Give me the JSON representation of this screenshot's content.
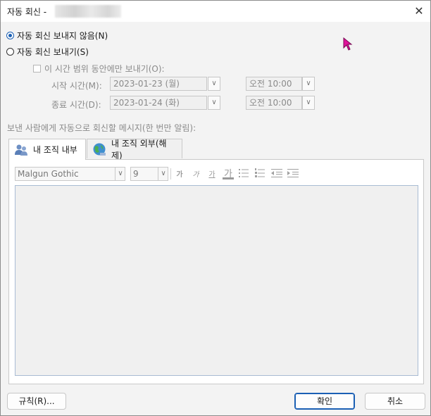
{
  "window": {
    "title": "자동 회신 -",
    "close_glyph": "✕"
  },
  "options": {
    "no_reply": "자동 회신 보내지 않음(N)",
    "send_reply": "자동 회신 보내기(S)",
    "time_range": "이 시간 범위 동안에만 보내기(O):"
  },
  "schedule": {
    "start_label": "시작 시간(M):",
    "start_date": "2023-01-23 (월)",
    "start_time": "오전 10:00",
    "end_label": "종료 시간(D):",
    "end_date": "2023-01-24 (화)",
    "end_time": "오전 10:00",
    "arrow": "∨"
  },
  "message": {
    "label": "보낸 사람에게 자동으로 회신할 메시지(한 번만 알림):"
  },
  "tabs": [
    {
      "label": "내 조직 내부",
      "icon": "users-icon"
    },
    {
      "label": "내 조직 외부(해제)",
      "icon": "globe-icon"
    }
  ],
  "format": {
    "font": "Malgun Gothic",
    "size": "9",
    "bold": "가",
    "italic": "가",
    "underline": "가",
    "color": "가"
  },
  "buttons": {
    "rules": "규칙(R)...",
    "ok": "확인",
    "cancel": "취소"
  },
  "colors": {
    "accent": "#1a5fb4",
    "cursor": "#e0129a"
  }
}
